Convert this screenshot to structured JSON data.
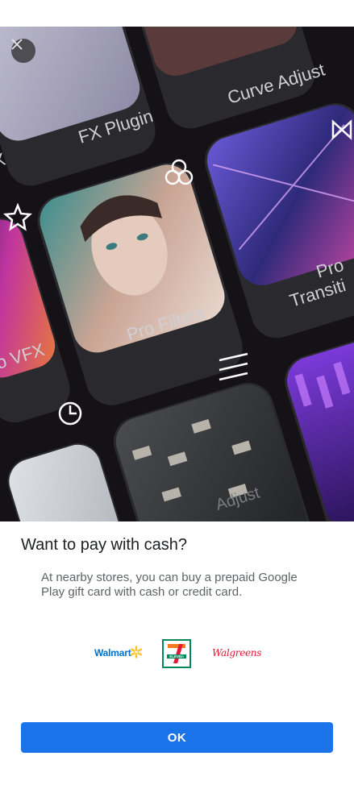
{
  "hero": {
    "cards": {
      "fx_plugin": "FX Plugin",
      "curve_adjust": "Curve Adjust",
      "pro_filters": "Pro Filters",
      "vfx": "o VFX",
      "pro_transition_line1": "Pro",
      "pro_transition_line2": "Transiti",
      "adjust": "Adjust",
      "left_partial": "X"
    }
  },
  "dialog": {
    "title": "Want to pay with cash?",
    "description": "At nearby stores, you can buy a prepaid Google Play gift card with cash or credit card.",
    "ok_label": "OK"
  },
  "stores": {
    "walmart": "Walmart",
    "seven_eleven": "ELEVEn",
    "walgreens": "Walgreens"
  },
  "colors": {
    "accent": "#1a73e8",
    "title_text": "#202124",
    "body_text": "#5f6368"
  },
  "icons": [
    "close-icon",
    "walmart-spark-icon",
    "star-icon",
    "filters-icon",
    "clock-icon",
    "sliders-icon",
    "bowtie-icon"
  ]
}
